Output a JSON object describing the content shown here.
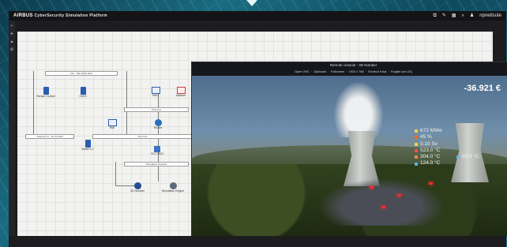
{
  "app": {
    "brand": "AIRBUS",
    "title": "CyberSecurity Simulation Platform",
    "user": "npnetisute"
  },
  "toolbar_icons": [
    "link-icon",
    "wrench-icon",
    "grid-icon",
    "search-icon",
    "user-icon"
  ],
  "left_icons": [
    "plus-icon",
    "pointer-icon",
    "chart-icon",
    "settings-icon"
  ],
  "network": {
    "buses": [
      "Ctrl - 192.168.0.0/24",
      "Prod bus",
      "Network LC - 10.0.0.0/24",
      "PLC bus",
      "Simulation Network"
    ],
    "nodes": [
      "Sensor Control",
      "SCE3",
      "HMI1",
      "Attacker",
      "HMI",
      "Router",
      "Switch 1",
      "Switch LC",
      "PLC 2022",
      "3D Number",
      "Simulation Engine"
    ]
  },
  "remote": {
    "title": "Remote console - 3D Number",
    "toolbar": [
      "Open VNC",
      "Clipboard",
      "Fullscreen",
      "1920 x 768",
      "Shortcut Keys",
      "English (en-US)"
    ],
    "money": "-36.921 €",
    "readings": [
      {
        "text": "672 MWe",
        "color": "#ffd23c"
      },
      {
        "text": "45 %",
        "color": "#ff6a00"
      },
      {
        "text": "0.10 Sv",
        "color": "#ffd23c"
      },
      {
        "text": "523.0 °C",
        "color": "#ff5050"
      },
      {
        "text": "304.0 °C",
        "color": "#ff8c40"
      },
      {
        "text": "124.0 °C",
        "color": "#5fb8e6"
      }
    ],
    "right_tag": "89.0 °C"
  }
}
